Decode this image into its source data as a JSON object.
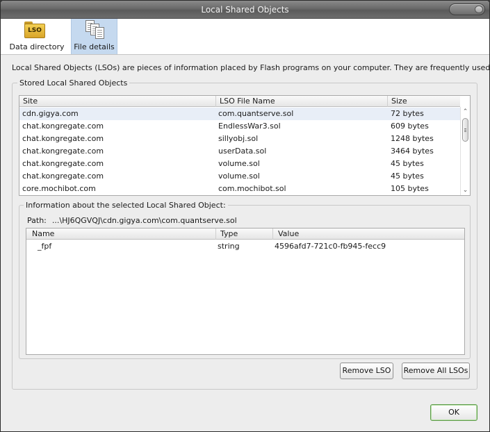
{
  "window": {
    "title": "Local Shared Objects"
  },
  "toolbar": {
    "items": [
      {
        "label": "Data directory",
        "icon": "folder-icon",
        "icon_text": "LSO"
      },
      {
        "label": "File details",
        "icon": "documents-icon",
        "selected": true
      }
    ]
  },
  "description": "Local Shared Objects (LSOs) are pieces of information placed by Flash programs on your computer. They are frequently used like cookies.",
  "stored": {
    "group_label": "Stored Local Shared Objects",
    "columns": [
      "Site",
      "LSO File Name",
      "Size"
    ],
    "rows": [
      {
        "site": "cdn.gigya.com",
        "file": "com.quantserve.sol",
        "size": "72 bytes",
        "selected": true
      },
      {
        "site": "chat.kongregate.com",
        "file": "EndlessWar3.sol",
        "size": "609 bytes"
      },
      {
        "site": "chat.kongregate.com",
        "file": "sillyobj.sol",
        "size": "1248 bytes"
      },
      {
        "site": "chat.kongregate.com",
        "file": "userData.sol",
        "size": "3464 bytes"
      },
      {
        "site": "chat.kongregate.com",
        "file": "volume.sol",
        "size": "45 bytes"
      },
      {
        "site": "chat.kongregate.com",
        "file": "volume.sol",
        "size": "45 bytes"
      },
      {
        "site": "core.mochibot.com",
        "file": "com.mochibot.sol",
        "size": "105 bytes"
      }
    ]
  },
  "info": {
    "group_label": "Information about the selected Local Shared Object:",
    "path_label": "Path:",
    "path_value": "...\\HJ6QGVQJ\\cdn.gigya.com\\com.quantserve.sol",
    "columns": [
      "Name",
      "Type",
      "Value"
    ],
    "rows": [
      {
        "name": "_fpf",
        "type": "string",
        "value": "4596afd7-721c0-fb945-fecc9"
      }
    ]
  },
  "buttons": {
    "remove_lso": "Remove LSO",
    "remove_all": "Remove All LSOs",
    "ok": "OK"
  },
  "colors": {
    "selected_tool_bg": "#c5d9ef",
    "selected_row_bg": "#e8eef7",
    "ok_border": "#5d9c4a"
  }
}
